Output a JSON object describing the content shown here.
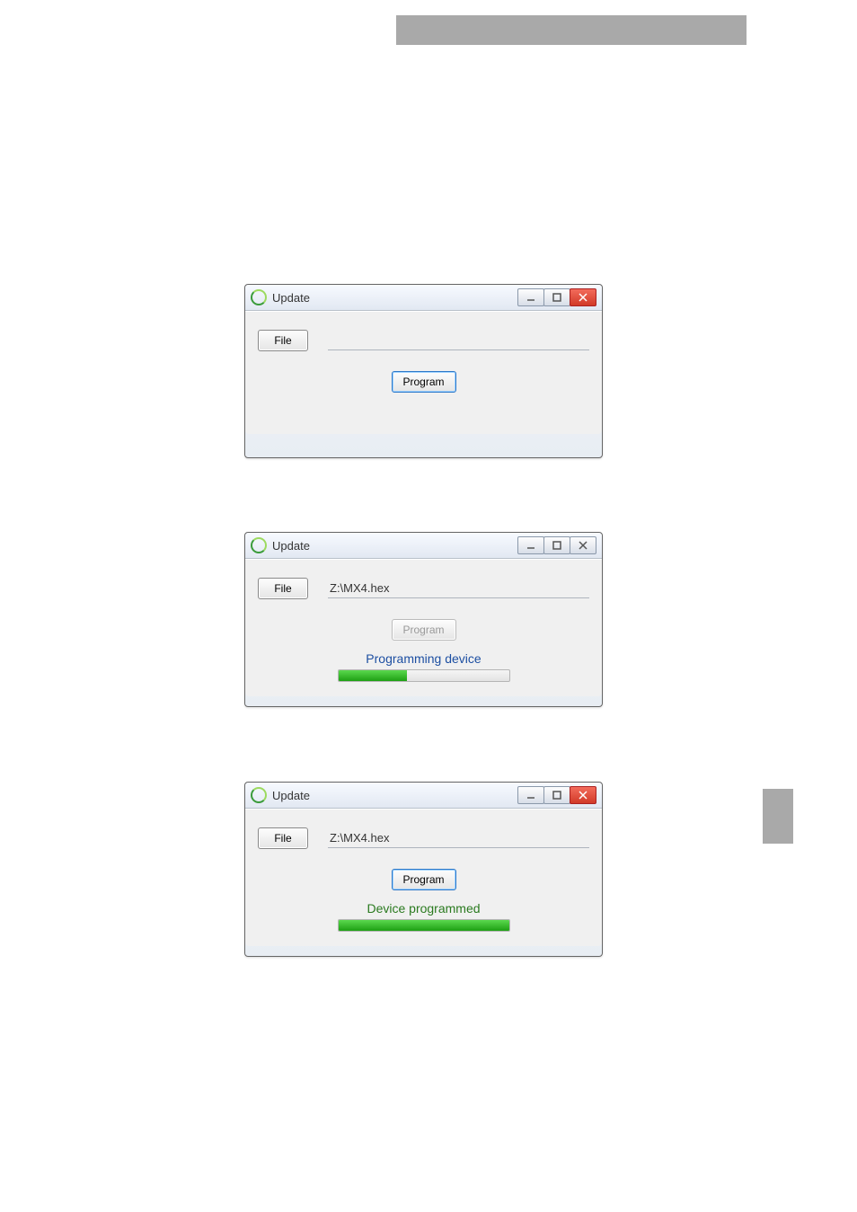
{
  "link_text": " ",
  "windows": {
    "w1": {
      "title": "Update",
      "file_button": "File",
      "file_value": "",
      "program_button": "Program"
    },
    "w2": {
      "title": "Update",
      "file_button": "File",
      "file_value": "Z:\\MX4.hex",
      "program_button": "Program",
      "status": "Programming device",
      "progress_percent": 40
    },
    "w3": {
      "title": "Update",
      "file_button": "File",
      "file_value": "Z:\\MX4.hex",
      "program_button": "Program",
      "status": "Device programmed",
      "progress_percent": 100
    }
  }
}
